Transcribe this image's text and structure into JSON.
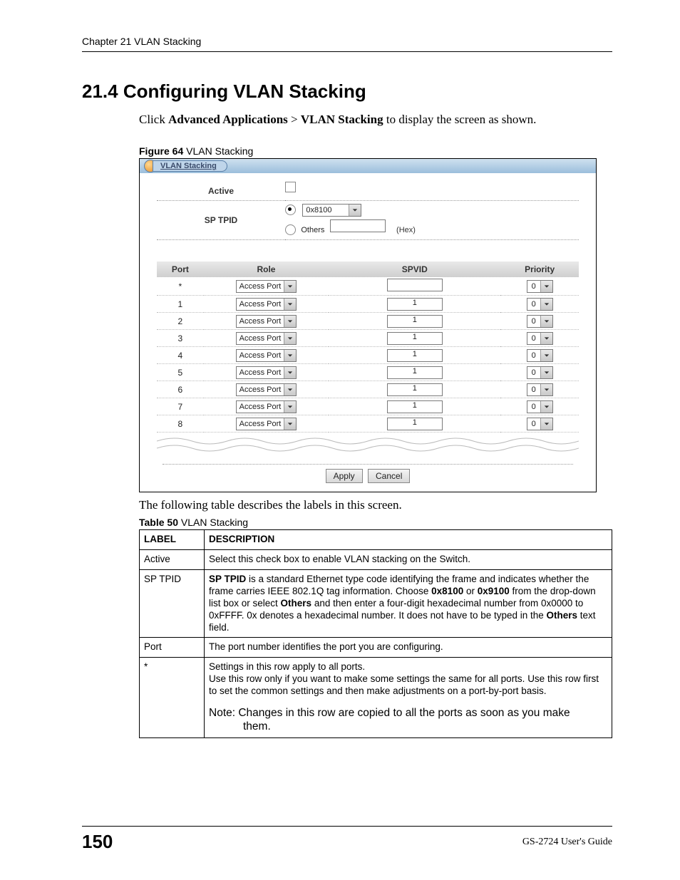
{
  "header": {
    "running": "Chapter 21 VLAN Stacking"
  },
  "section": {
    "title": "21.4  Configuring VLAN Stacking",
    "intro_prefix": "Click ",
    "intro_b1": "Advanced Applications",
    "intro_mid": " > ",
    "intro_b2": "VLAN Stacking",
    "intro_suffix": " to display the screen as shown."
  },
  "figure": {
    "num": "Figure 64",
    "title": "   VLAN Stacking",
    "panel_title": "VLAN Stacking",
    "labels": {
      "active": "Active",
      "sp_tpid": "SP TPID",
      "others": "Others",
      "hex": "(Hex)"
    },
    "tpid_select_value": "0x8100",
    "columns": {
      "port": "Port",
      "role": "Role",
      "spvid": "SPVID",
      "priority": "Priority"
    },
    "rows": [
      {
        "port": "*",
        "role": "Access Port",
        "spvid": "",
        "priority": "0"
      },
      {
        "port": "1",
        "role": "Access Port",
        "spvid": "1",
        "priority": "0"
      },
      {
        "port": "2",
        "role": "Access Port",
        "spvid": "1",
        "priority": "0"
      },
      {
        "port": "3",
        "role": "Access Port",
        "spvid": "1",
        "priority": "0"
      },
      {
        "port": "4",
        "role": "Access Port",
        "spvid": "1",
        "priority": "0"
      },
      {
        "port": "5",
        "role": "Access Port",
        "spvid": "1",
        "priority": "0"
      },
      {
        "port": "6",
        "role": "Access Port",
        "spvid": "1",
        "priority": "0"
      },
      {
        "port": "7",
        "role": "Access Port",
        "spvid": "1",
        "priority": "0"
      },
      {
        "port": "8",
        "role": "Access Port",
        "spvid": "1",
        "priority": "0"
      }
    ],
    "buttons": {
      "apply": "Apply",
      "cancel": "Cancel"
    }
  },
  "after_fig": "The following table describes the labels in this screen.",
  "table": {
    "num": "Table 50",
    "title": "   VLAN Stacking",
    "head": {
      "label": "LABEL",
      "desc": "DESCRIPTION"
    },
    "rows": {
      "active": {
        "label": "Active",
        "desc": "Select this check box to enable VLAN stacking on the Switch."
      },
      "sptpid": {
        "label": "SP TPID",
        "b1": "SP TPID",
        "t1": " is a standard Ethernet type code identifying the frame and indicates whether the frame carries IEEE 802.1Q tag information. Choose ",
        "b2": "0x8100",
        "t2": " or ",
        "b3": "0x9100",
        "t3": " from the drop-down list box or select ",
        "b4": "Others",
        "t4": " and then enter a four-digit hexadecimal number from 0x0000 to 0xFFFF. 0x denotes a hexadecimal number. It does not have to be typed in the ",
        "b5": "Others",
        "t5": " text field."
      },
      "port": {
        "label": "Port",
        "desc": "The port number identifies the port you are configuring."
      },
      "star": {
        "label": "*",
        "l1": "Settings in this row apply to all ports.",
        "l2": "Use this row only if you want to make some settings the same for all ports. Use this row first to set the common settings and then make adjustments on a port-by-port basis.",
        "note1": "Note: Changes in this row are copied to all the ports as soon as you make ",
        "note2": "them."
      }
    }
  },
  "footer": {
    "page": "150",
    "guide": "GS-2724 User's Guide"
  }
}
